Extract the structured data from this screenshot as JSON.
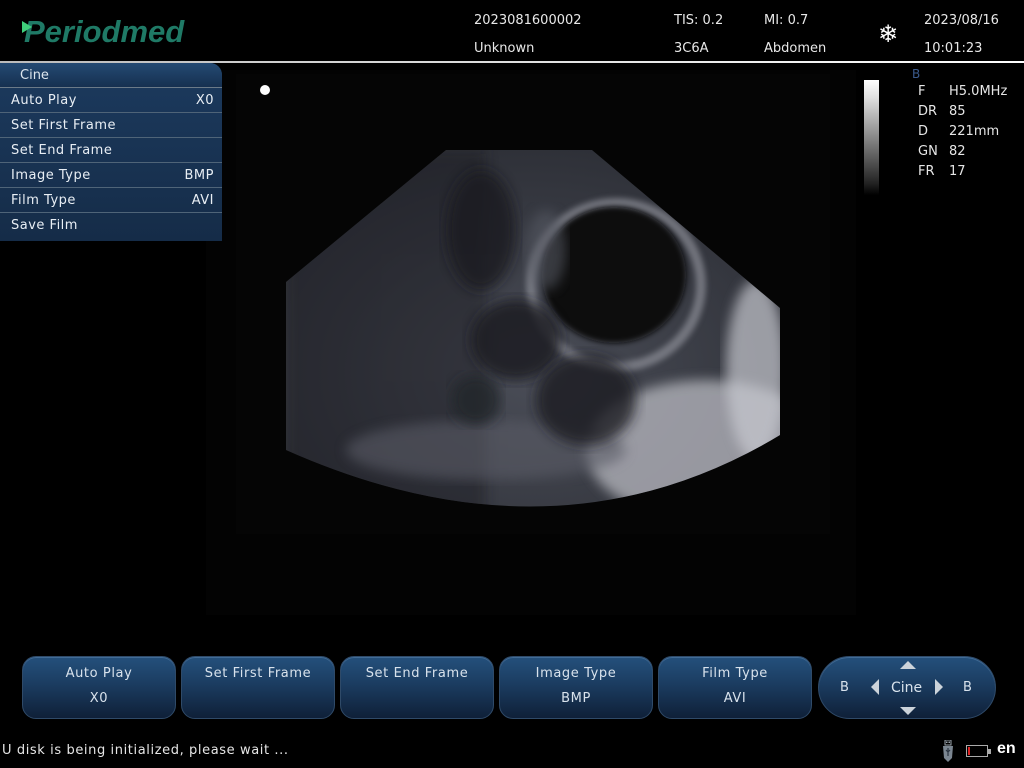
{
  "header": {
    "logo": "Periodmed",
    "patient_id": "2023081600002",
    "patient_name": "Unknown",
    "tis": "TIS: 0.2",
    "mi": "MI: 0.7",
    "probe": "3C6A",
    "exam": "Abdomen",
    "date": "2023/08/16",
    "time": "10:01:23",
    "freeze_icon": "snowflake-icon"
  },
  "cine_menu": {
    "title": "Cine",
    "items": [
      {
        "label": "Auto Play",
        "value": "X0"
      },
      {
        "label": "Set First Frame",
        "value": ""
      },
      {
        "label": "Set End Frame",
        "value": ""
      },
      {
        "label": "Image Type",
        "value": "BMP"
      },
      {
        "label": "Film Type",
        "value": "AVI"
      },
      {
        "label": "Save Film",
        "value": ""
      }
    ]
  },
  "params": {
    "mode": "B",
    "rows": [
      {
        "key": "F",
        "value": "H5.0MHz"
      },
      {
        "key": "DR",
        "value": "85"
      },
      {
        "key": "D",
        "value": "221mm"
      },
      {
        "key": "GN",
        "value": "82"
      },
      {
        "key": "FR",
        "value": "17"
      }
    ]
  },
  "soft_buttons": [
    {
      "line1": "Auto Play",
      "line2": "X0"
    },
    {
      "line1": "Set First Frame",
      "line2": ""
    },
    {
      "line1": "Set End Frame",
      "line2": ""
    },
    {
      "line1": "Image Type",
      "line2": "BMP"
    },
    {
      "line1": "Film Type",
      "line2": "AVI"
    }
  ],
  "nav_button": {
    "left": "B",
    "center": "Cine",
    "right": "B"
  },
  "status": {
    "message": "U disk is being initialized, please wait ...",
    "language": "en",
    "battery_level": 0.1
  }
}
